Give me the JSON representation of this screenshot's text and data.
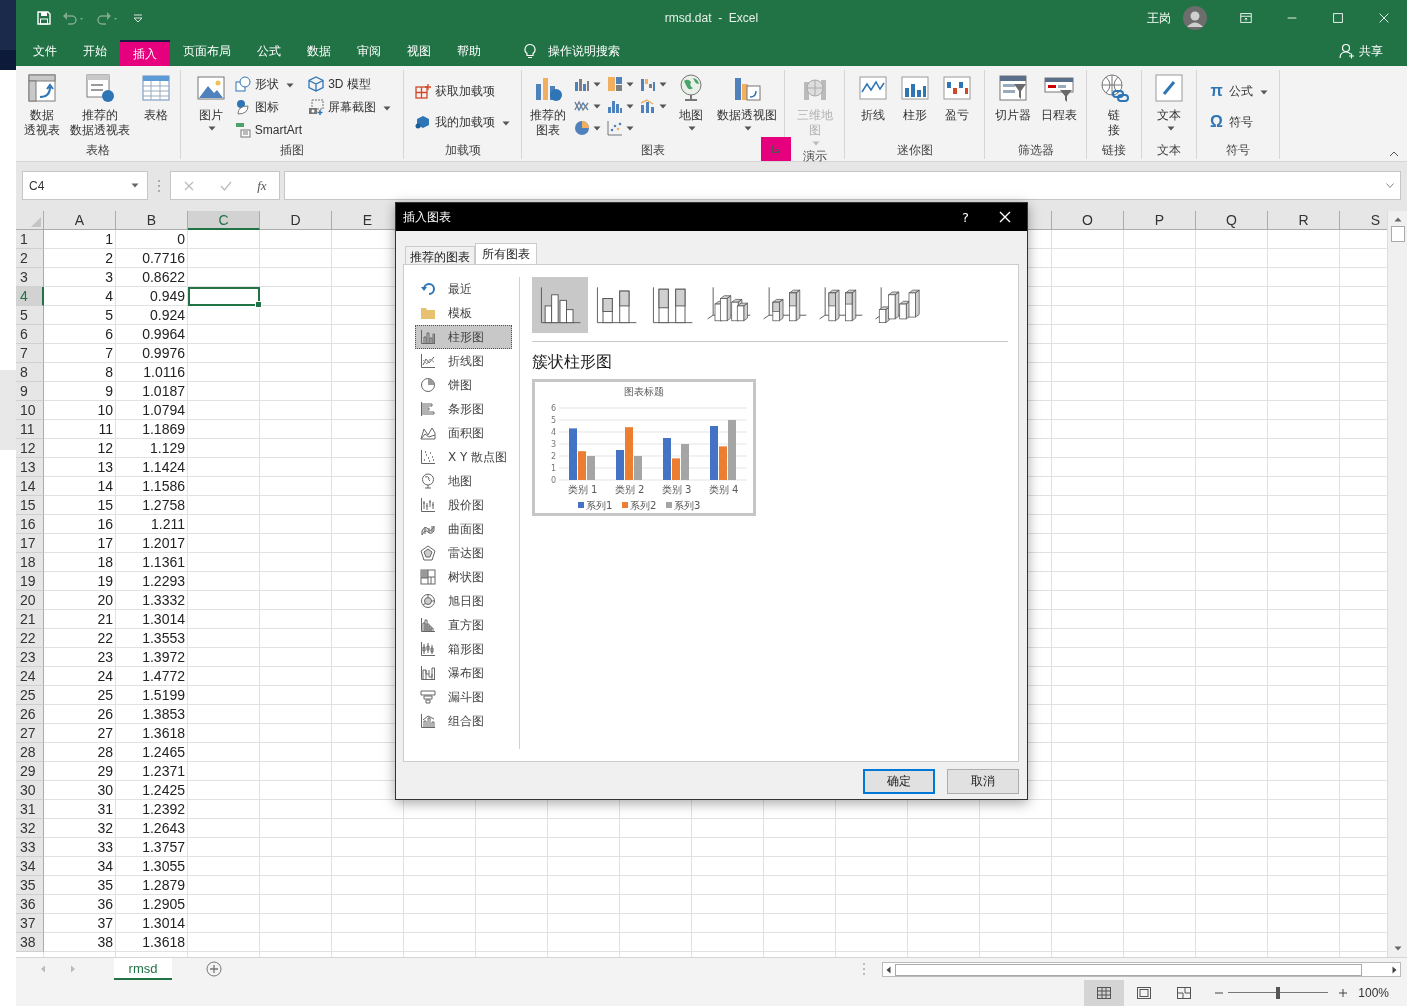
{
  "window": {
    "title": "rmsd.dat  -  Excel",
    "user": "王岗"
  },
  "tabs": [
    {
      "label": "文件",
      "selected": false
    },
    {
      "label": "开始",
      "selected": false
    },
    {
      "label": "插入",
      "selected": true
    },
    {
      "label": "页面布局",
      "selected": false
    },
    {
      "label": "公式",
      "selected": false
    },
    {
      "label": "数据",
      "selected": false
    },
    {
      "label": "审阅",
      "selected": false
    },
    {
      "label": "视图",
      "selected": false
    },
    {
      "label": "帮助",
      "selected": false
    }
  ],
  "tell_me": "操作说明搜索",
  "share": "共享",
  "ribbon": {
    "groups": [
      {
        "label": "表格",
        "launcher": false,
        "items": [
          {
            "kind": "large",
            "lines": [
              "数据",
              "透视表"
            ],
            "dropdown": false,
            "disabled": false
          },
          {
            "kind": "large",
            "lines": [
              "推荐的",
              "数据透视表"
            ],
            "dropdown": false,
            "disabled": false
          },
          {
            "kind": "large",
            "lines": [
              "表格"
            ],
            "dropdown": false,
            "disabled": false
          }
        ]
      },
      {
        "label": "插图",
        "launcher": false,
        "items": [
          {
            "kind": "large",
            "lines": [
              "图片"
            ],
            "dropdown": true,
            "disabled": false
          },
          {
            "kind": "stack",
            "entries": [
              {
                "label": "形状",
                "dropdown": true
              },
              {
                "label": "图标",
                "dropdown": false
              },
              {
                "label": "SmartArt",
                "dropdown": false
              }
            ]
          },
          {
            "kind": "stack",
            "entries": [
              {
                "label": "3D 模型",
                "dropdown": false
              },
              {
                "label": "屏幕截图",
                "dropdown": true
              }
            ]
          }
        ]
      },
      {
        "label": "加载项",
        "launcher": false,
        "items": [
          {
            "kind": "stack",
            "entries": [
              {
                "label": "获取加载项",
                "dropdown": false
              },
              {
                "label": "我的加载项",
                "dropdown": true
              }
            ]
          }
        ]
      },
      {
        "label": "图表",
        "launcher": true,
        "items": [
          {
            "kind": "large",
            "lines": [
              "推荐的",
              "图表"
            ],
            "dropdown": false,
            "disabled": false
          },
          {
            "kind": "icon_grid"
          },
          {
            "kind": "large",
            "lines": [
              "地图"
            ],
            "dropdown": true,
            "disabled": false
          },
          {
            "kind": "large",
            "lines": [
              "数据透视图"
            ],
            "dropdown": true,
            "disabled": false
          }
        ]
      },
      {
        "label": "演示",
        "launcher": false,
        "items": [
          {
            "kind": "large",
            "lines": [
              "三维地",
              "图"
            ],
            "dropdown": true,
            "disabled": true
          }
        ]
      },
      {
        "label": "迷你图",
        "launcher": false,
        "items": [
          {
            "kind": "large",
            "lines": [
              "折线"
            ],
            "dropdown": false,
            "disabled": false
          },
          {
            "kind": "large",
            "lines": [
              "柱形"
            ],
            "dropdown": false,
            "disabled": false
          },
          {
            "kind": "large",
            "lines": [
              "盈亏"
            ],
            "dropdown": false,
            "disabled": false
          }
        ]
      },
      {
        "label": "筛选器",
        "launcher": false,
        "items": [
          {
            "kind": "large",
            "lines": [
              "切片器"
            ],
            "dropdown": false,
            "disabled": false
          },
          {
            "kind": "large",
            "lines": [
              "日程表"
            ],
            "dropdown": false,
            "disabled": false
          }
        ]
      },
      {
        "label": "链接",
        "launcher": false,
        "items": [
          {
            "kind": "large",
            "lines": [
              "链",
              "接"
            ],
            "dropdown": false,
            "disabled": false
          }
        ]
      },
      {
        "label": "文本",
        "launcher": false,
        "items": [
          {
            "kind": "large",
            "lines": [
              "文本"
            ],
            "dropdown": true,
            "disabled": false
          }
        ]
      },
      {
        "label": "符号",
        "launcher": false,
        "items": [
          {
            "kind": "stack",
            "entries": [
              {
                "glyph": "π",
                "label": "公式",
                "dropdown": true
              },
              {
                "glyph": "Ω",
                "label": "符号",
                "dropdown": false
              }
            ]
          }
        ]
      }
    ]
  },
  "formula_bar": {
    "name_box": "C4",
    "fx": "fx"
  },
  "sheet": {
    "columns": [
      {
        "label": "A",
        "selected": false
      },
      {
        "label": "B",
        "selected": false
      },
      {
        "label": "C",
        "selected": true
      },
      {
        "label": "D",
        "selected": false
      },
      {
        "label": "E",
        "selected": false
      },
      {
        "label": "O",
        "selected": false
      },
      {
        "label": "P",
        "selected": false
      },
      {
        "label": "Q",
        "selected": false
      },
      {
        "label": "R",
        "selected": false
      },
      {
        "label": "S",
        "selected": false
      }
    ],
    "rows": [
      {
        "label": "1",
        "a": "1",
        "b": "0",
        "selected": false
      },
      {
        "label": "2",
        "a": "2",
        "b": "0.7716",
        "selected": false
      },
      {
        "label": "3",
        "a": "3",
        "b": "0.8622",
        "selected": false
      },
      {
        "label": "4",
        "a": "4",
        "b": "0.949",
        "selected": true
      },
      {
        "label": "5",
        "a": "5",
        "b": "0.924",
        "selected": false
      },
      {
        "label": "6",
        "a": "6",
        "b": "0.9964",
        "selected": false
      },
      {
        "label": "7",
        "a": "7",
        "b": "0.9976",
        "selected": false
      },
      {
        "label": "8",
        "a": "8",
        "b": "1.0116",
        "selected": false
      },
      {
        "label": "9",
        "a": "9",
        "b": "1.0187",
        "selected": false
      },
      {
        "label": "10",
        "a": "10",
        "b": "1.0794",
        "selected": false
      },
      {
        "label": "11",
        "a": "11",
        "b": "1.1869",
        "selected": false
      },
      {
        "label": "12",
        "a": "12",
        "b": "1.129",
        "selected": false
      },
      {
        "label": "13",
        "a": "13",
        "b": "1.1424",
        "selected": false
      },
      {
        "label": "14",
        "a": "14",
        "b": "1.1586",
        "selected": false
      },
      {
        "label": "15",
        "a": "15",
        "b": "1.2758",
        "selected": false
      },
      {
        "label": "16",
        "a": "16",
        "b": "1.211",
        "selected": false
      },
      {
        "label": "17",
        "a": "17",
        "b": "1.2017",
        "selected": false
      },
      {
        "label": "18",
        "a": "18",
        "b": "1.1361",
        "selected": false
      },
      {
        "label": "19",
        "a": "19",
        "b": "1.2293",
        "selected": false
      },
      {
        "label": "20",
        "a": "20",
        "b": "1.3332",
        "selected": false
      },
      {
        "label": "21",
        "a": "21",
        "b": "1.3014",
        "selected": false
      },
      {
        "label": "22",
        "a": "22",
        "b": "1.3553",
        "selected": false
      },
      {
        "label": "23",
        "a": "23",
        "b": "1.3972",
        "selected": false
      },
      {
        "label": "24",
        "a": "24",
        "b": "1.4772",
        "selected": false
      },
      {
        "label": "25",
        "a": "25",
        "b": "1.5199",
        "selected": false
      },
      {
        "label": "26",
        "a": "26",
        "b": "1.3853",
        "selected": false
      },
      {
        "label": "27",
        "a": "27",
        "b": "1.3618",
        "selected": false
      },
      {
        "label": "28",
        "a": "28",
        "b": "1.2465",
        "selected": false
      },
      {
        "label": "29",
        "a": "29",
        "b": "1.2371",
        "selected": false
      },
      {
        "label": "30",
        "a": "30",
        "b": "1.2425",
        "selected": false
      },
      {
        "label": "31",
        "a": "31",
        "b": "1.2392",
        "selected": false
      },
      {
        "label": "32",
        "a": "32",
        "b": "1.2643",
        "selected": false
      },
      {
        "label": "33",
        "a": "33",
        "b": "1.3757",
        "selected": false
      },
      {
        "label": "34",
        "a": "34",
        "b": "1.3055",
        "selected": false
      },
      {
        "label": "35",
        "a": "35",
        "b": "1.2879",
        "selected": false
      },
      {
        "label": "36",
        "a": "36",
        "b": "1.2905",
        "selected": false
      },
      {
        "label": "37",
        "a": "37",
        "b": "1.3014",
        "selected": false
      },
      {
        "label": "38",
        "a": "38",
        "b": "1.3618",
        "selected": false
      }
    ]
  },
  "sheet_tabs": [
    {
      "label": "rmsd",
      "selected": true
    }
  ],
  "status_bar": {
    "views": [
      {
        "kind": "normal",
        "selected": true
      },
      {
        "kind": "page_layout",
        "selected": false
      },
      {
        "kind": "page_break",
        "selected": false
      }
    ],
    "zoom": {
      "level": 0.5,
      "reading": "100%"
    }
  },
  "dialog": {
    "title": "插入图表",
    "help": "?",
    "tabs": [
      {
        "label": "推荐的图表",
        "selected": false
      },
      {
        "label": "所有图表",
        "selected": true
      }
    ],
    "types": [
      {
        "label": "最近",
        "selected": false
      },
      {
        "label": "模板",
        "selected": false
      },
      {
        "label": "柱形图",
        "selected": true
      },
      {
        "label": "折线图",
        "selected": false
      },
      {
        "label": "饼图",
        "selected": false
      },
      {
        "label": "条形图",
        "selected": false
      },
      {
        "label": "面积图",
        "selected": false
      },
      {
        "label": "X Y 散点图",
        "selected": false
      },
      {
        "label": "地图",
        "selected": false
      },
      {
        "label": "股价图",
        "selected": false
      },
      {
        "label": "曲面图",
        "selected": false
      },
      {
        "label": "雷达图",
        "selected": false
      },
      {
        "label": "树状图",
        "selected": false
      },
      {
        "label": "旭日图",
        "selected": false
      },
      {
        "label": "直方图",
        "selected": false
      },
      {
        "label": "箱形图",
        "selected": false
      },
      {
        "label": "瀑布图",
        "selected": false
      },
      {
        "label": "漏斗图",
        "selected": false
      },
      {
        "label": "组合图",
        "selected": false
      }
    ],
    "subtypes": [
      {
        "kind": "clustered",
        "selected": true
      },
      {
        "kind": "stacked",
        "selected": false
      },
      {
        "kind": "percent",
        "selected": false
      },
      {
        "kind": "clustered3d",
        "selected": false
      },
      {
        "kind": "stacked3d",
        "selected": false
      },
      {
        "kind": "percent3d",
        "selected": false
      },
      {
        "kind": "column3d",
        "selected": false
      }
    ],
    "subtype_title": "簇状柱形图",
    "preview": {
      "chart_data": {
        "type": "bar",
        "title": "图表标题",
        "categories": [
          "类别 1",
          "类别 2",
          "类别 3",
          "类别 4"
        ],
        "series": [
          {
            "name": "系列1",
            "color": "#4472c4",
            "values": [
              4.3,
              2.5,
              3.5,
              4.5
            ]
          },
          {
            "name": "系列2",
            "color": "#ed7d31",
            "values": [
              2.4,
              4.4,
              1.8,
              2.8
            ]
          },
          {
            "name": "系列3",
            "color": "#a5a5a5",
            "values": [
              2,
              2,
              3,
              5
            ]
          }
        ],
        "ylim": [
          0,
          6
        ],
        "yticks": [
          0,
          1,
          2,
          3,
          4,
          5,
          6
        ],
        "grid": true,
        "legend": "bottom"
      }
    },
    "buttons": [
      {
        "label": "确定",
        "default": true
      },
      {
        "label": "取消",
        "default": false
      }
    ]
  }
}
